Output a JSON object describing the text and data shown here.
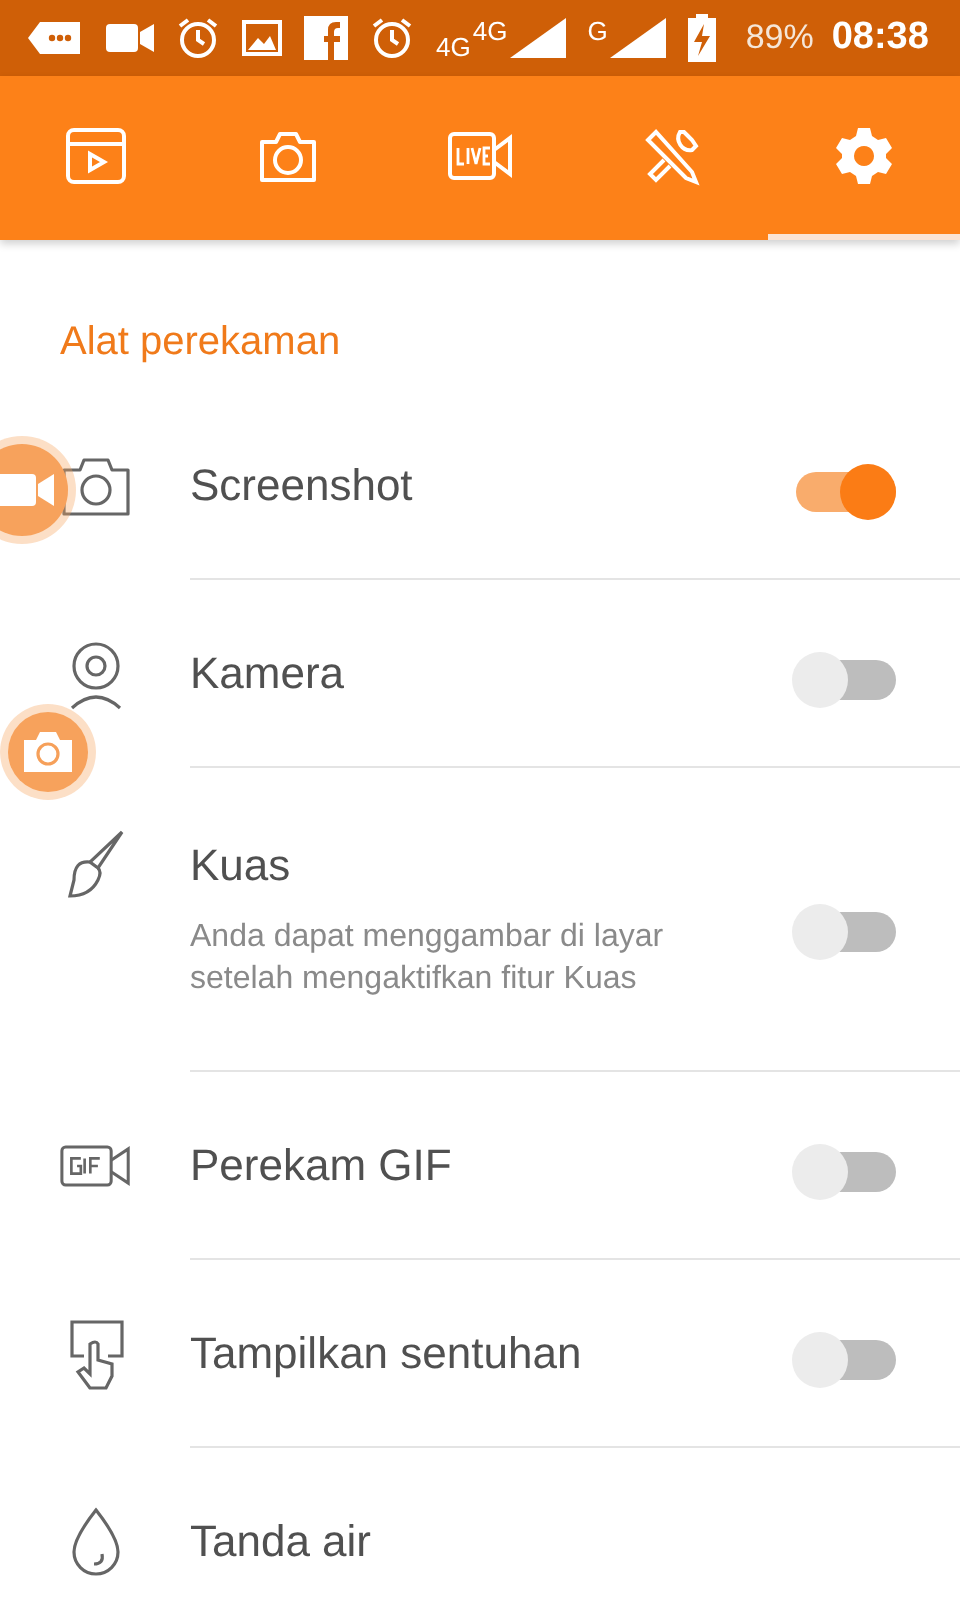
{
  "status_bar": {
    "network_labels": [
      "4G",
      "4G",
      "G"
    ],
    "battery": "89%",
    "time": "08:38"
  },
  "tabs": [
    {
      "kind": "clips",
      "selected": false
    },
    {
      "kind": "camera",
      "selected": false
    },
    {
      "kind": "live",
      "selected": false
    },
    {
      "kind": "tools",
      "selected": false
    },
    {
      "kind": "settings",
      "selected": true
    }
  ],
  "section": {
    "title": "Alat perekaman"
  },
  "items": [
    {
      "kind": "camera",
      "title": "Screenshot",
      "on": true
    },
    {
      "kind": "webcam",
      "title": "Kamera",
      "on": false
    },
    {
      "kind": "brush",
      "title": "Kuas",
      "description": "Anda dapat menggambar di layar setelah mengaktifkan fitur Kuas",
      "on": false
    },
    {
      "kind": "gif",
      "title": "Perekam GIF",
      "on": false
    },
    {
      "kind": "touch",
      "title": "Tampilkan sentuhan",
      "on": false
    },
    {
      "kind": "drop",
      "title": "Tanda air"
    }
  ],
  "floating_buttons": [
    {
      "kind": "record"
    },
    {
      "kind": "camera"
    }
  ]
}
